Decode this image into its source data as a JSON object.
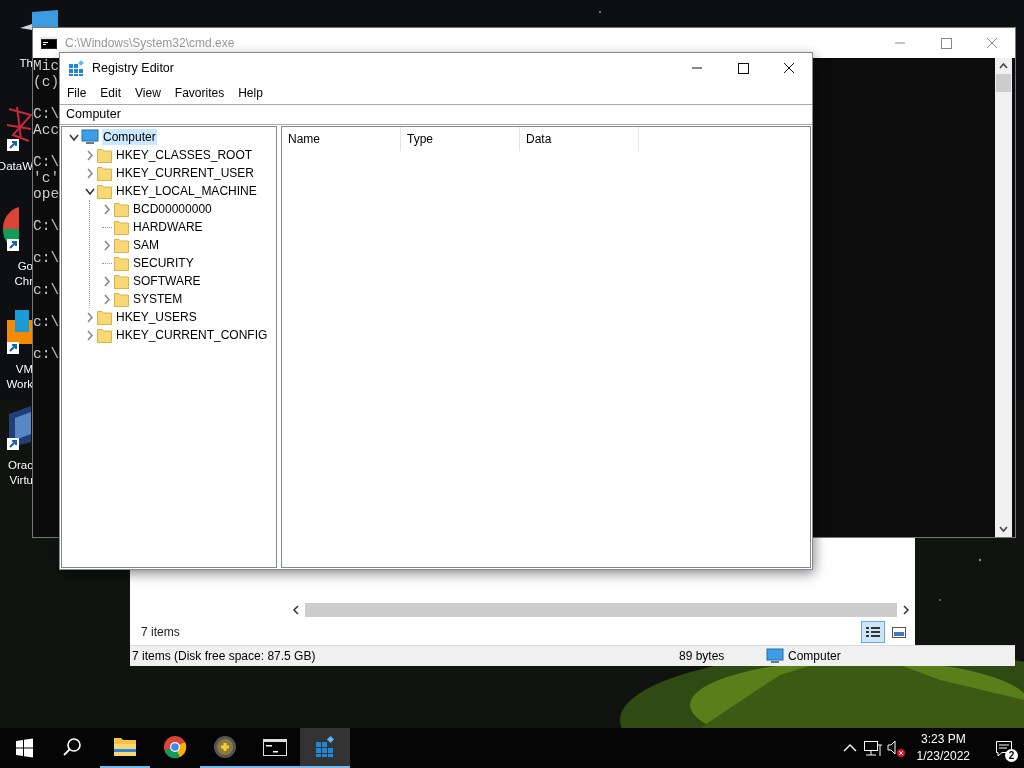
{
  "desktop_icons": [
    {
      "kind": "pc",
      "lines": [
        "Th"
      ]
    },
    {
      "kind": "network",
      "lines": [
        "DataW"
      ]
    },
    {
      "kind": "browser",
      "lines": [
        "Go",
        "Chr"
      ]
    },
    {
      "kind": "vm",
      "lines": [
        "VM",
        "Work"
      ]
    },
    {
      "kind": "box",
      "lines": [
        "Orac",
        "Virtu"
      ]
    }
  ],
  "cmd_window": {
    "title": "C:\\Windows\\System32\\cmd.exe",
    "paragraphs": [
      [
        "Mic",
        "(c)"
      ],
      [
        "C:\\",
        "Acc"
      ],
      [
        "C:\\",
        "'c'",
        "ope"
      ],
      [
        "C:\\"
      ],
      [
        "c:\\"
      ],
      [
        "c:\\"
      ],
      [
        "c:\\"
      ],
      [
        "c:\\"
      ]
    ]
  },
  "explorer_window": {
    "item_count": "7 items",
    "views": [
      {
        "kind": "details",
        "selected": true
      },
      {
        "kind": "tiles",
        "selected": false
      }
    ],
    "status_bar": {
      "summary": "7 items (Disk free space: 87.5 GB)",
      "size": "89 bytes",
      "location": "Computer"
    }
  },
  "registry_editor": {
    "title": "Registry Editor",
    "menu": [
      "File",
      "Edit",
      "View",
      "Favorites",
      "Help"
    ],
    "address": "Computer",
    "tree": [
      {
        "label": "Computer",
        "kind": "computer",
        "expanded": true,
        "selected": true,
        "children": [
          {
            "label": "HKEY_CLASSES_ROOT",
            "kind": "branch",
            "expanded": false,
            "selected": false
          },
          {
            "label": "HKEY_CURRENT_USER",
            "kind": "branch",
            "expanded": false,
            "selected": false
          },
          {
            "label": "HKEY_LOCAL_MACHINE",
            "kind": "branch",
            "expanded": true,
            "selected": false,
            "children": [
              {
                "label": "BCD00000000",
                "kind": "branch",
                "expanded": false,
                "selected": false
              },
              {
                "label": "HARDWARE",
                "kind": "leaf",
                "selected": false
              },
              {
                "label": "SAM",
                "kind": "branch",
                "expanded": false,
                "selected": false
              },
              {
                "label": "SECURITY",
                "kind": "leaf",
                "selected": false
              },
              {
                "label": "SOFTWARE",
                "kind": "branch",
                "expanded": false,
                "selected": false
              },
              {
                "label": "SYSTEM",
                "kind": "branch",
                "expanded": false,
                "selected": false
              }
            ]
          },
          {
            "label": "HKEY_USERS",
            "kind": "branch",
            "expanded": false,
            "selected": false
          },
          {
            "label": "HKEY_CURRENT_CONFIG",
            "kind": "branch",
            "expanded": false,
            "selected": false
          }
        ]
      }
    ],
    "columns": [
      "Name",
      "Type",
      "Data"
    ]
  },
  "taskbar": {
    "apps": [
      {
        "kind": "explorer",
        "running": true,
        "active": false
      },
      {
        "kind": "chrome",
        "running": false,
        "active": false
      },
      {
        "kind": "orb",
        "running": true,
        "active": false
      },
      {
        "kind": "cmd",
        "running": true,
        "active": false
      },
      {
        "kind": "regedit",
        "running": true,
        "active": true
      }
    ],
    "volume": {
      "muted": true
    },
    "clock": {
      "time": "3:23 PM",
      "date": "1/23/2022"
    },
    "notifications": {
      "count": "2"
    }
  }
}
